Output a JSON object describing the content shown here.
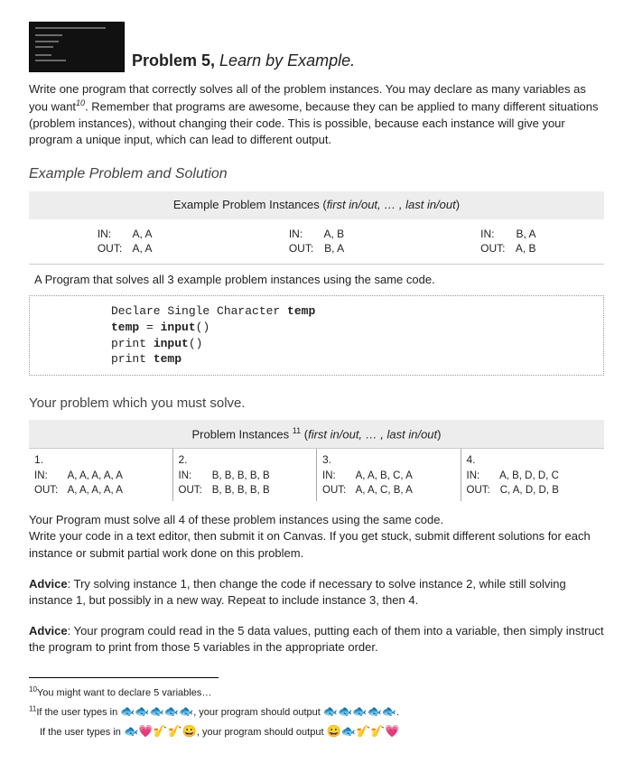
{
  "title": {
    "main": "Problem 5",
    "sub": "Learn by Example."
  },
  "intro": {
    "part1": "Write one program that correctly solves all of the problem instances. You may declare as many variables as you want",
    "sup": "10",
    "part2": ". Remember that programs are awesome, because they can be applied to many different situations (problem instances), without changing their code. This is possible, because each instance will give your program a unique input, which can lead to different output."
  },
  "example_section_title": "Example Problem and Solution",
  "example_header": {
    "prefix": "Example Problem Instances (",
    "ital": "first in/out, … , last in/out",
    "suffix": ")"
  },
  "example_io": [
    {
      "in": "A, A",
      "out": "A, A"
    },
    {
      "in": "A, B",
      "out": "B, A"
    },
    {
      "in": "B, A",
      "out": "A, B"
    }
  ],
  "program_note": "A Program that solves all 3 example problem instances using the same code.",
  "code": {
    "l1a": "Declare Single Character ",
    "l1b": "temp",
    "l2a": "temp",
    "l2b": " = ",
    "l2c": "input",
    "l2d": "()",
    "l3a": "print ",
    "l3b": "input",
    "l3c": "()",
    "l4a": "print ",
    "l4b": "temp"
  },
  "your_title": "Your problem which you must solve.",
  "problem_header": {
    "prefix": "Problem Instances ",
    "sup": "11",
    "mid": " (",
    "ital": "first in/out, … , last in/out",
    "suffix": ")"
  },
  "problem_io": [
    {
      "num": "1.",
      "in": "A, A, A, A, A",
      "out": "A, A, A, A, A"
    },
    {
      "num": "2.",
      "in": "B, B, B, B, B",
      "out": "B, B, B, B, B"
    },
    {
      "num": "3.",
      "in": "A, A, B, C, A",
      "out": "A, A, C, B, A"
    },
    {
      "num": "4.",
      "in": "A, B, D, D, C",
      "out": "C, A, D, D, B"
    }
  ],
  "must_solve": "Your Program must solve all 4 of these problem instances using the same code.\nWrite your code in a text editor, then submit it on Canvas. If you get stuck, submit different solutions for each instance or submit partial work done on this problem.",
  "advice1": {
    "label": "Advice",
    "text": ": Try solving instance 1, then change the code if necessary to solve instance 2, while still solving instance 1, but possibly in a new way. Repeat to include instance 3, then 4."
  },
  "advice2": {
    "label": "Advice",
    "text": ": Your program could read in the 5 data values, putting each of them into a variable, then simply instruct the program to print from those 5 variables in the appropriate order."
  },
  "footnotes": {
    "f10": {
      "sup": "10",
      "text": "You might want to declare 5 variables…"
    },
    "f11a": {
      "sup": "11",
      "pre": "If the user types in ",
      "emoji_in": "🐟🐟🐟🐟🐟",
      "mid": ", your program should output ",
      "emoji_out": "🐟🐟🐟🐟🐟",
      "post": "."
    },
    "f11b": {
      "pre": "If the user types in ",
      "emoji_in": "🐟💗🎷🎷😀",
      "mid": ", your program should output ",
      "emoji_out": "😀🐟🎷🎷💗"
    }
  },
  "labels": {
    "in": "IN:",
    "out": "OUT:"
  }
}
